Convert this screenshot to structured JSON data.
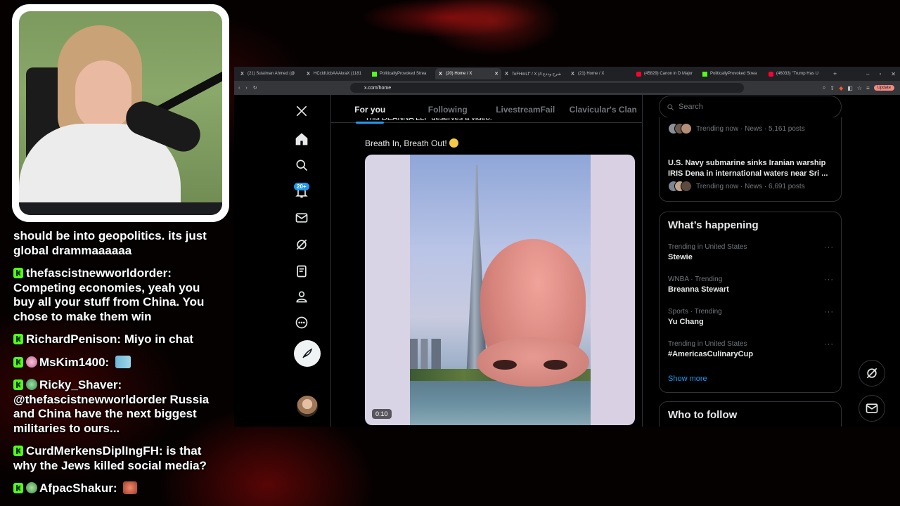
{
  "chat": [
    {
      "user": "",
      "text": "should be into geopolitics. its just global drammaaaaaa"
    },
    {
      "user": "thefascistnewworldorder:",
      "text": "Competing economies, yeah you buy all your stuff from China. You chose to make them win"
    },
    {
      "user": "RichardPenison:",
      "text": "Miyo in chat"
    },
    {
      "user": "MsKim1400:",
      "text": ""
    },
    {
      "user": "Ricky_Shaver:",
      "text": "@thefascistnewworldorder Russia and China have the next biggest militaries to ours..."
    },
    {
      "user": "CurdMerkensDiplIngFH:",
      "text": "is that why the Jews killed social media?"
    },
    {
      "user": "AfpacShakur:",
      "text": ""
    }
  ],
  "browser": {
    "tabs": [
      {
        "label": "(21) Sulaiman Ahmed (@",
        "icon": "x-icon"
      },
      {
        "label": "HCcldUcbAAAkraX (1181",
        "icon": "x-icon"
      },
      {
        "label": "PoliticallyProvoked Strea",
        "icon": "kick-icon"
      },
      {
        "label": "(20) Home / X",
        "icon": "x-icon",
        "active": true
      },
      {
        "label": "ToFHmLf\" / X (4 شرح وددع",
        "icon": "x-icon"
      },
      {
        "label": "(21) Home / X",
        "icon": "x-icon"
      },
      {
        "label": "(45829) Canon in D Major",
        "icon": "youtube-icon"
      },
      {
        "label": "PoliticallyProvoked Strea",
        "icon": "kick-icon"
      },
      {
        "label": "(46033) \"Trump Has U",
        "icon": "youtube-icon"
      }
    ],
    "url": "x.com/home",
    "update_label": "Update"
  },
  "x": {
    "tabs": [
      "For you",
      "Following",
      "LivestreamFail",
      "Clavicular's Clan"
    ],
    "notif_count": "20+",
    "cut_text": "This DEANNA LLP deserves a video.",
    "post_text": "Breath In, Breath Out!",
    "video_time": "0:10",
    "search_placeholder": "Search",
    "trending_now_1": "Trending now · News · 5,161 posts",
    "news_title": "U.S. Navy submarine sinks Iranian warship IRIS Dena in international waters near Sri ...",
    "trending_now_2": "Trending now · News · 6,691 posts",
    "whats_happening": "What’s happening",
    "trends": [
      {
        "meta": "Trending in United States",
        "name": "Stewie"
      },
      {
        "meta": "WNBA · Trending",
        "name": "Breanna Stewart"
      },
      {
        "meta": "Sports · Trending",
        "name": "Yu Chang"
      },
      {
        "meta": "Trending in United States",
        "name": "#AmericasCulinaryCup"
      }
    ],
    "show_more": "Show more",
    "who_to_follow": "Who to follow"
  }
}
